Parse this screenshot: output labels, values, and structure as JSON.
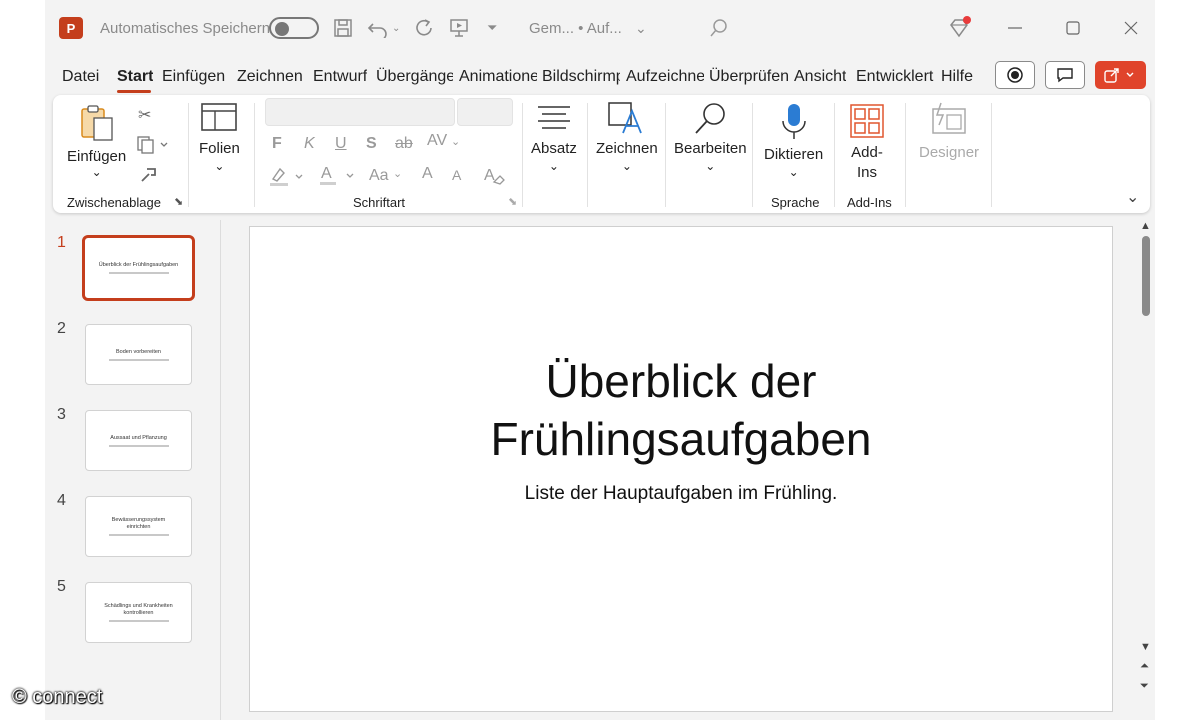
{
  "titlebar": {
    "autosave_label": "Automatisches Speichern",
    "doc_title": "Gem...  • Auf...",
    "app_letter": "P"
  },
  "tabs": [
    {
      "label": "Datei"
    },
    {
      "label": "Start"
    },
    {
      "label": "Einfügen"
    },
    {
      "label": "Zeichnen"
    },
    {
      "label": "Entwurf"
    },
    {
      "label": "Übergänge"
    },
    {
      "label": "Animationen"
    },
    {
      "label": "Bildschirmpräsentation"
    },
    {
      "label": "Aufzeichnen"
    },
    {
      "label": "Überprüfen"
    },
    {
      "label": "Ansicht"
    },
    {
      "label": "Entwicklertools"
    },
    {
      "label": "Hilfe"
    }
  ],
  "ribbon": {
    "paste_label": "Einfügen",
    "clipboard_group": "Zwischenablage",
    "slides_label": "Folien",
    "font_group": "Schriftart",
    "font_buttons": {
      "bold": "F",
      "italic": "K",
      "underline": "U",
      "strike": "S",
      "strike2": "ab",
      "spacing": "AV",
      "case": "Aa",
      "grow": "A",
      "shrink": "A"
    },
    "paragraph_label": "Absatz",
    "draw_label": "Zeichnen",
    "edit_label": "Bearbeiten",
    "dictate_label": "Diktieren",
    "voice_group": "Sprache",
    "addins_label_1": "Add-",
    "addins_label_2": "Ins",
    "addins_group": "Add-Ins",
    "designer_label": "Designer"
  },
  "slides": [
    {
      "num": "1",
      "title": "Überblick der Frühlingsaufgaben"
    },
    {
      "num": "2",
      "title": "Boden vorbereiten"
    },
    {
      "num": "3",
      "title": "Aussaat und Pflanzung"
    },
    {
      "num": "4",
      "title": "Bewässerungssystem einrichten"
    },
    {
      "num": "5",
      "title": "Schädlings und Krankheiten kontrollieren"
    }
  ],
  "current_slide": {
    "title_line1": "Überblick der",
    "title_line2": "Frühlingsaufgaben",
    "subtitle": "Liste der Hauptaufgaben im Frühling."
  },
  "watermark": "© connect",
  "colors": {
    "accent": "#c43e1c",
    "dictate_blue": "#2b7cd3"
  }
}
